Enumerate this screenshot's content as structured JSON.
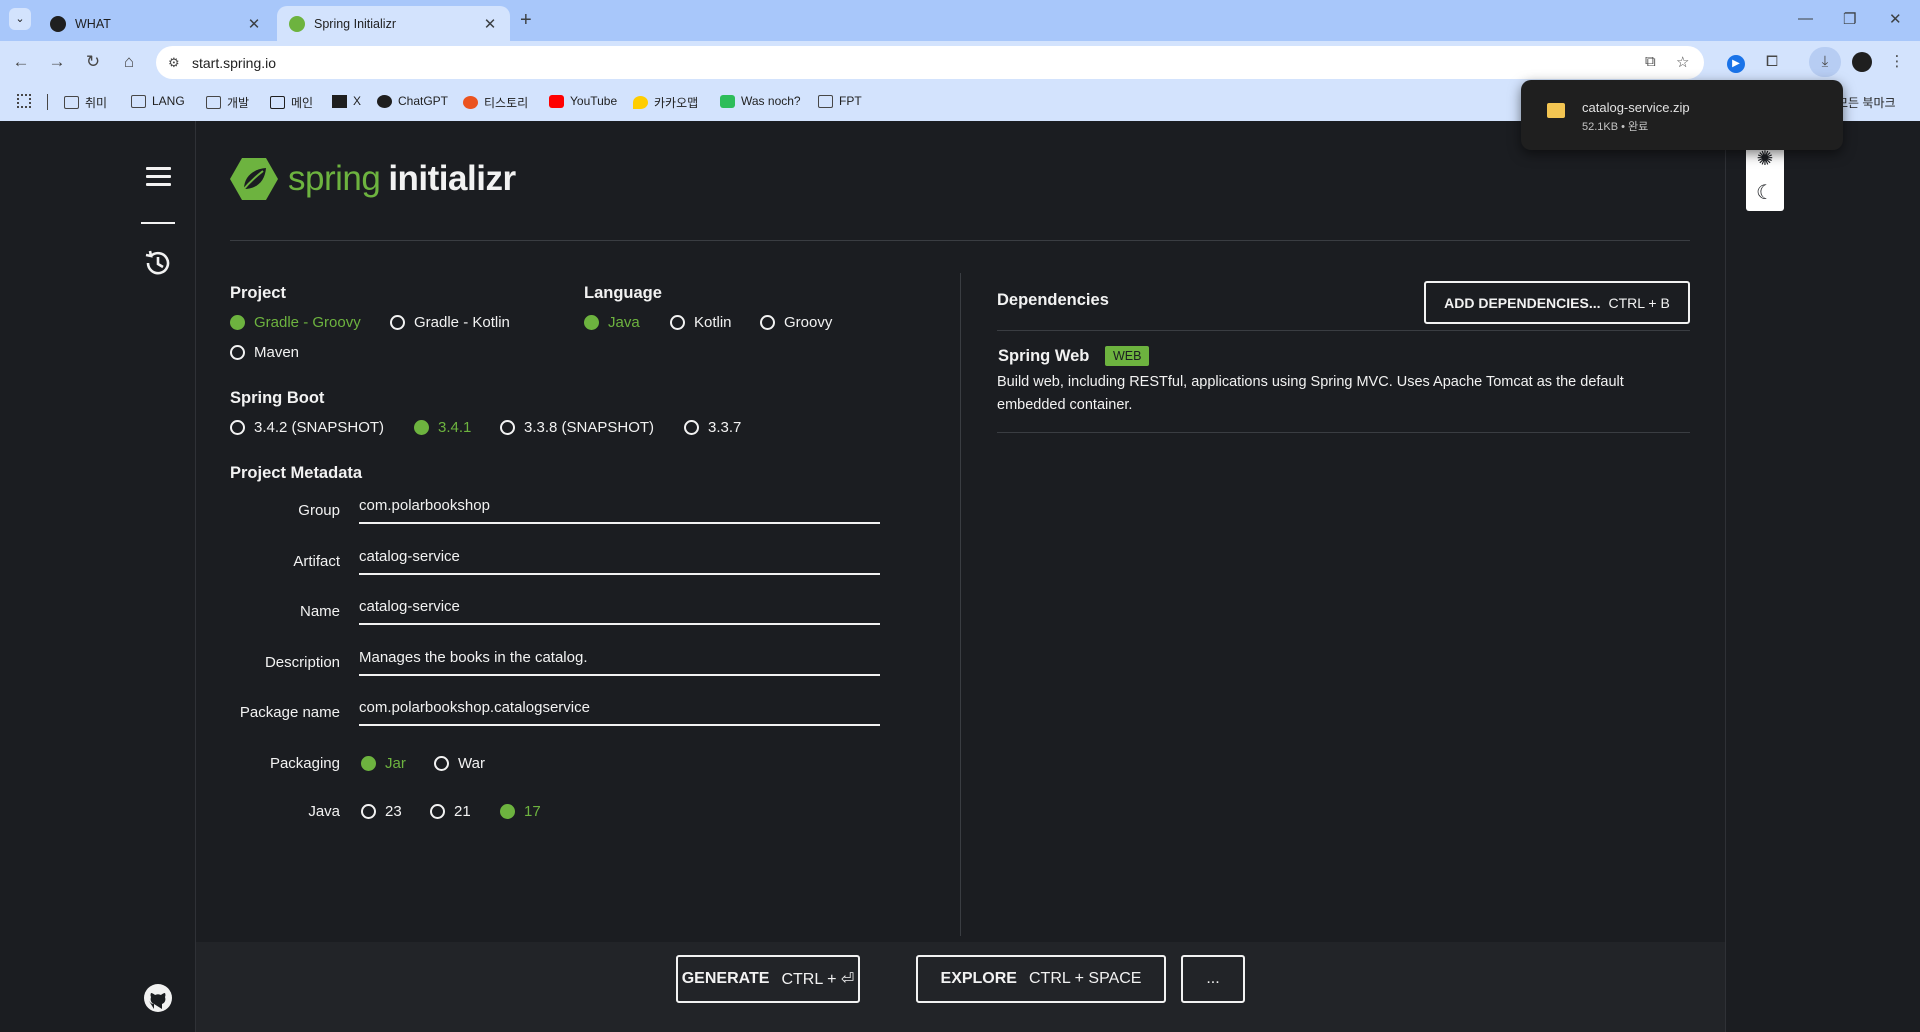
{
  "browser": {
    "tabs": [
      {
        "title": "WHAT",
        "active": false
      },
      {
        "title": "Spring Initializr",
        "active": true
      }
    ],
    "url": "start.spring.io",
    "bookmarks": [
      "취미",
      "LANG",
      "개발",
      "메인",
      "X",
      "ChatGPT",
      "티스토리",
      "YouTube",
      "카카오맵",
      "Was noch?",
      "FPT"
    ],
    "all_bookmarks": "모든 북마크",
    "download": {
      "filename": "catalog-service.zip",
      "meta": "52.1KB • 완료"
    }
  },
  "brand": {
    "word1": "spring",
    "word2": "initializr",
    "color": "#6db33f"
  },
  "project": {
    "title": "Project",
    "options": [
      "Gradle - Groovy",
      "Gradle - Kotlin",
      "Maven"
    ],
    "selected": "Gradle - Groovy"
  },
  "language": {
    "title": "Language",
    "options": [
      "Java",
      "Kotlin",
      "Groovy"
    ],
    "selected": "Java"
  },
  "spring_boot": {
    "title": "Spring Boot",
    "options": [
      "3.4.2 (SNAPSHOT)",
      "3.4.1",
      "3.3.8 (SNAPSHOT)",
      "3.3.7"
    ],
    "selected": "3.4.1"
  },
  "metadata": {
    "title": "Project Metadata",
    "group_label": "Group",
    "group": "com.polarbookshop",
    "artifact_label": "Artifact",
    "artifact": "catalog-service",
    "name_label": "Name",
    "name": "catalog-service",
    "description_label": "Description",
    "description": "Manages the books in the catalog.",
    "package_label": "Package name",
    "package": "com.polarbookshop.catalogservice",
    "packaging_label": "Packaging",
    "packaging_options": [
      "Jar",
      "War"
    ],
    "packaging_selected": "Jar",
    "java_label": "Java",
    "java_options": [
      "23",
      "21",
      "17"
    ],
    "java_selected": "17"
  },
  "dependencies": {
    "title": "Dependencies",
    "add_button": "ADD DEPENDENCIES...",
    "add_shortcut": "CTRL + B",
    "items": [
      {
        "name": "Spring Web",
        "badge": "WEB",
        "description": "Build web, including RESTful, applications using Spring MVC. Uses Apache Tomcat as the default embedded container."
      }
    ]
  },
  "footer": {
    "generate": "GENERATE",
    "generate_shortcut": "CTRL + ⏎",
    "explore": "EXPLORE",
    "explore_shortcut": "CTRL + SPACE",
    "more": "..."
  }
}
